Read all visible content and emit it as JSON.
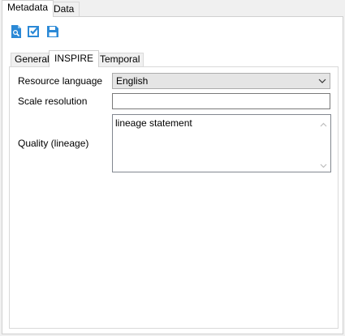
{
  "outer_tabs": [
    {
      "label": "Metadata",
      "active": true
    },
    {
      "label": "Data",
      "active": false
    }
  ],
  "toolbar": {
    "icons": [
      "document-search-icon",
      "checkbox-icon",
      "save-icon"
    ],
    "accent": "#2b89d6"
  },
  "inner_tabs": [
    {
      "label": "General",
      "active": false
    },
    {
      "label": "INSPIRE",
      "active": true
    },
    {
      "label": "Temporal",
      "active": false
    }
  ],
  "form": {
    "resource_language": {
      "label": "Resource language",
      "value": "English"
    },
    "scale_resolution": {
      "label": "Scale resolution",
      "value": ""
    },
    "quality_lineage": {
      "label": "Quality (lineage)",
      "value": "lineage statement"
    }
  }
}
